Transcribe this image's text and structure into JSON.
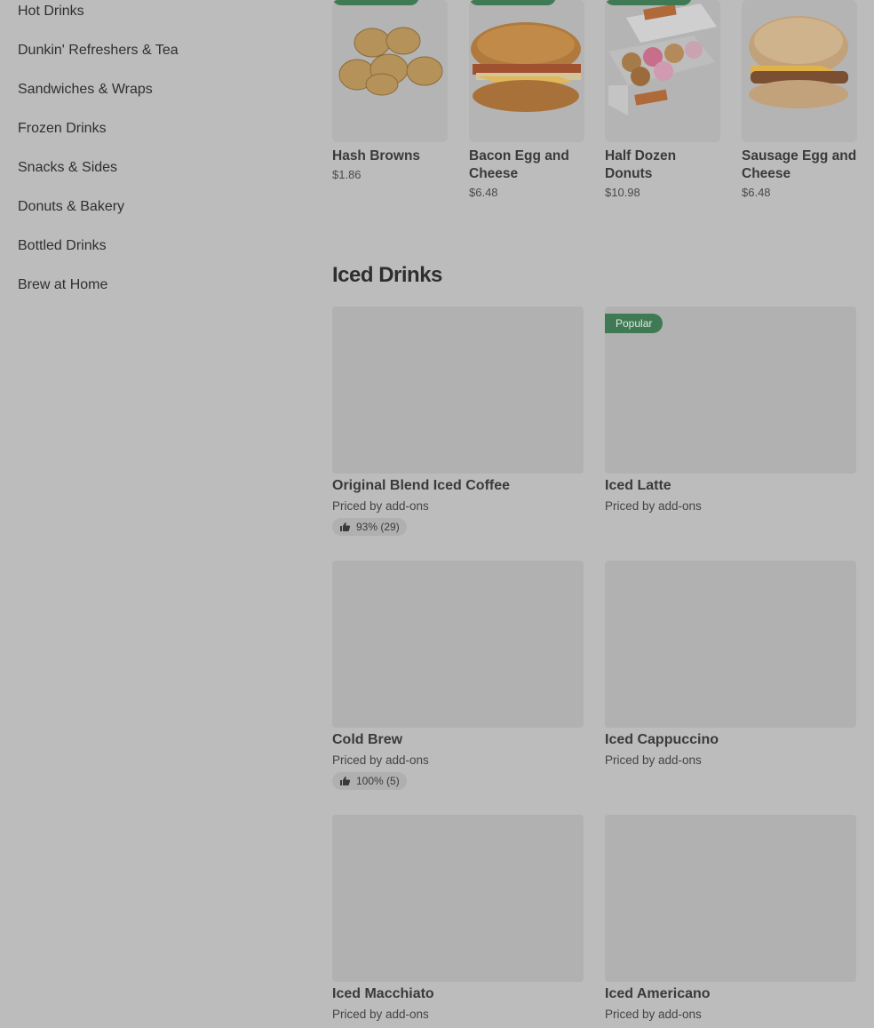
{
  "sidebar": {
    "items": [
      {
        "label": "Hot Drinks"
      },
      {
        "label": "Dunkin' Refreshers & Tea"
      },
      {
        "label": "Sandwiches & Wraps"
      },
      {
        "label": "Frozen Drinks"
      },
      {
        "label": "Snacks & Sides"
      },
      {
        "label": "Donuts & Bakery"
      },
      {
        "label": "Bottled Drinks"
      },
      {
        "label": "Brew at Home"
      }
    ]
  },
  "featured": [
    {
      "name": "Hash Browns",
      "price": "$1.86"
    },
    {
      "name": "Bacon Egg and Cheese",
      "price": "$6.48"
    },
    {
      "name": "Half Dozen Donuts",
      "price": "$10.98"
    },
    {
      "name": "Sausage Egg and Cheese",
      "price": "$6.48"
    }
  ],
  "section": {
    "title": "Iced Drinks"
  },
  "items": [
    {
      "name": "Original Blend Iced Coffee",
      "sub": "Priced by add-ons",
      "rating": "93% (29)"
    },
    {
      "name": "Iced Latte",
      "sub": "Priced by add-ons",
      "badge": "Popular"
    },
    {
      "name": "Cold Brew",
      "sub": "Priced by add-ons",
      "rating": "100% (5)"
    },
    {
      "name": "Iced Cappuccino",
      "sub": "Priced by add-ons"
    },
    {
      "name": "Iced Macchiato",
      "sub": "Priced by add-ons"
    },
    {
      "name": "Iced Americano",
      "sub": "Priced by add-ons"
    }
  ],
  "colors": {
    "accent": "#3f7a55",
    "overlay": "#bcbcbc"
  }
}
